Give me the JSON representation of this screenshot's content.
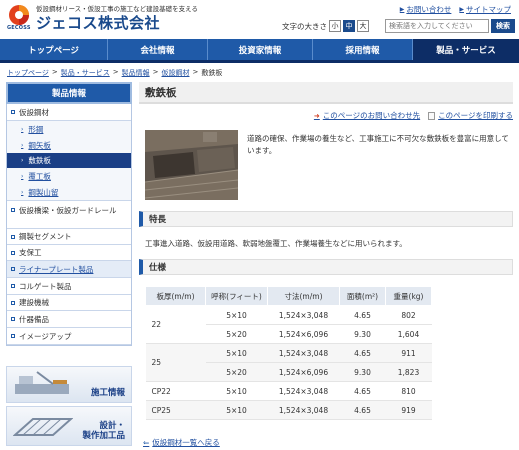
{
  "header": {
    "tagline": "仮設鋼材リース・仮設工事の施工など建設基礎を支える",
    "company": "ジェコス株式会社",
    "logo_text": "GECOSS",
    "links": [
      {
        "label": "お問い合わせ"
      },
      {
        "label": "サイトマップ"
      }
    ],
    "font_size_label": "文字の大きさ",
    "font_size_options": [
      "小",
      "中",
      "大"
    ],
    "font_size_selected": "中",
    "search_placeholder": "検索語を入力してください",
    "search_button": "検索"
  },
  "gnav": [
    "トップページ",
    "会社情報",
    "投資家情報",
    "採用情報",
    "製品・サービス"
  ],
  "gnav_active": "製品・サービス",
  "breadcrumb": [
    {
      "label": "トップページ",
      "link": true
    },
    {
      "label": "製品・サービス",
      "link": true
    },
    {
      "label": "製品情報",
      "link": true
    },
    {
      "label": "仮設鋼材",
      "link": true
    },
    {
      "label": "敷鉄板",
      "link": false
    }
  ],
  "sidebar": {
    "title": "製品情報",
    "items": [
      {
        "label": "仮設鋼材",
        "level": 0
      },
      {
        "label": "形鋼",
        "level": 1
      },
      {
        "label": "鋼矢板",
        "level": 1
      },
      {
        "label": "敷鉄板",
        "level": 1,
        "active": true
      },
      {
        "label": "覆工板",
        "level": 1
      },
      {
        "label": "鋼製山留",
        "level": 1
      },
      {
        "label": "仮設橋梁・仮設ガードレール",
        "level": 0
      },
      {
        "label": "鋼製セグメント",
        "level": 0
      },
      {
        "label": "支保工",
        "level": 0
      },
      {
        "label": "ライナープレート製品",
        "level": 0,
        "highlight": true
      },
      {
        "label": "コルゲート製品",
        "level": 0
      },
      {
        "label": "建設機械",
        "level": 0
      },
      {
        "label": "什器備品",
        "level": 0
      },
      {
        "label": "イメージアップ",
        "level": 0
      }
    ],
    "banners": [
      {
        "label": "施工情報"
      },
      {
        "label": "設計・\n製作加工品"
      }
    ]
  },
  "main": {
    "title": "敷鉄板",
    "contact_link": "このページのお問い合わせ先",
    "print_link": "このページを印刷する",
    "intro": "道路の確保、作業場の養生など、工事施工に不可欠な敷鉄板を豊富に用意しています。",
    "feature_heading": "特長",
    "feature_text": "工事進入道路、仮設用道路、軟弱地盤覆工、作業場養生などに用いられます。",
    "spec_heading": "仕様",
    "spec_table": {
      "headers": [
        "板厚(m/m)",
        "呼称(フィート)",
        "寸法(m/m)",
        "面積(m²)",
        "重量(kg)"
      ],
      "groups": [
        {
          "thickness": "22",
          "rows": [
            [
              "5×10",
              "1,524×3,048",
              "4.65",
              "802"
            ],
            [
              "5×20",
              "1,524×6,096",
              "9.30",
              "1,604"
            ]
          ]
        },
        {
          "thickness": "25",
          "rows": [
            [
              "5×10",
              "1,524×3,048",
              "4.65",
              "911"
            ],
            [
              "5×20",
              "1,524×6,096",
              "9.30",
              "1,823"
            ]
          ]
        },
        {
          "thickness": "CP22",
          "rows": [
            [
              "5×10",
              "1,524×3,048",
              "4.65",
              "810"
            ]
          ]
        },
        {
          "thickness": "CP25",
          "rows": [
            [
              "5×10",
              "1,524×3,048",
              "4.65",
              "919"
            ]
          ]
        }
      ]
    },
    "back_link": "仮設鋼材一覧へ戻る"
  },
  "colors": {
    "brand_blue": "#1f5aa8",
    "dark_blue": "#0d2d66",
    "accent_red": "#d23b1e"
  }
}
